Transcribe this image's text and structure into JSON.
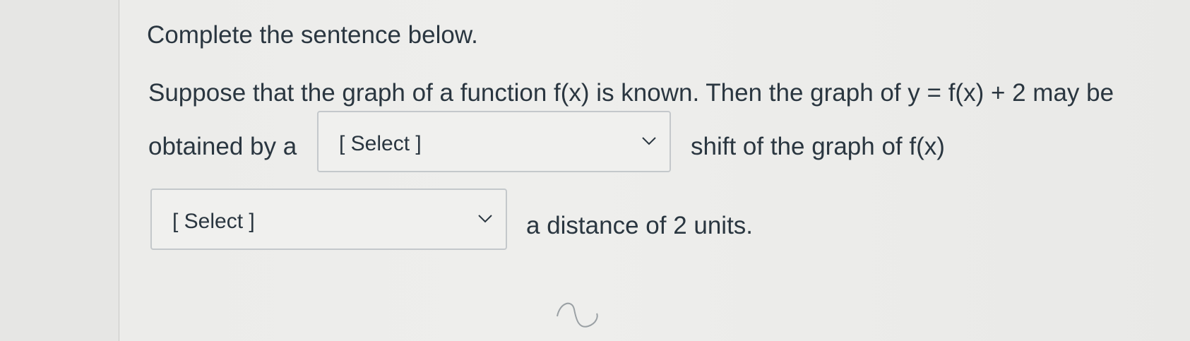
{
  "question": {
    "title": "Complete the sentence below.",
    "line1": "Suppose that the graph of a function f(x) is known. Then the graph of y = f(x) + 2  may be",
    "line2_before": "obtained by a",
    "line2_after": "shift of the graph of  f(x)",
    "line3_after": "a distance of 2 units."
  },
  "dropdowns": {
    "first": {
      "label": "[ Select ]",
      "icon": "chevron-down-icon"
    },
    "second": {
      "label": "[ Select ]",
      "icon": "chevron-down-icon"
    }
  }
}
